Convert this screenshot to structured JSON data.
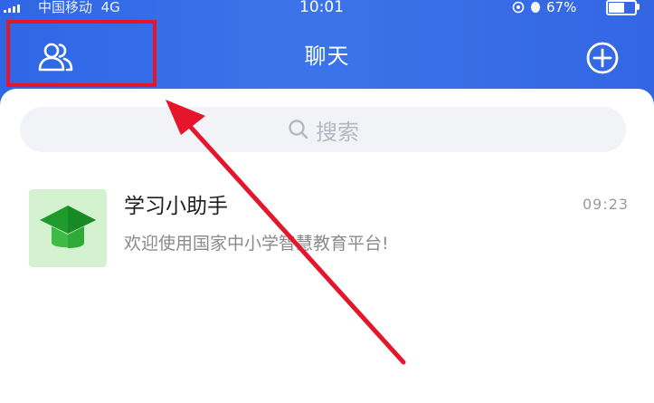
{
  "status_bar": {
    "carrier": "中国移动",
    "network": "4G",
    "time": "10:01",
    "battery": "67%",
    "battery_level": 0.67
  },
  "header": {
    "title": "聊天",
    "contacts_icon": "contacts-icon",
    "add_icon": "plus-circle-icon",
    "background_color": "#3670e8"
  },
  "search": {
    "placeholder": "搜索"
  },
  "conversations": [
    {
      "name": "学习小助手",
      "time": "09:23",
      "preview": "欢迎使用国家中小学智慧教育平台!",
      "avatar_icon": "graduation-cap-icon",
      "avatar_color": "#d4f2cf"
    }
  ],
  "annotation": {
    "highlight_color": "#e5152b",
    "arrow_color": "#e5152b"
  }
}
